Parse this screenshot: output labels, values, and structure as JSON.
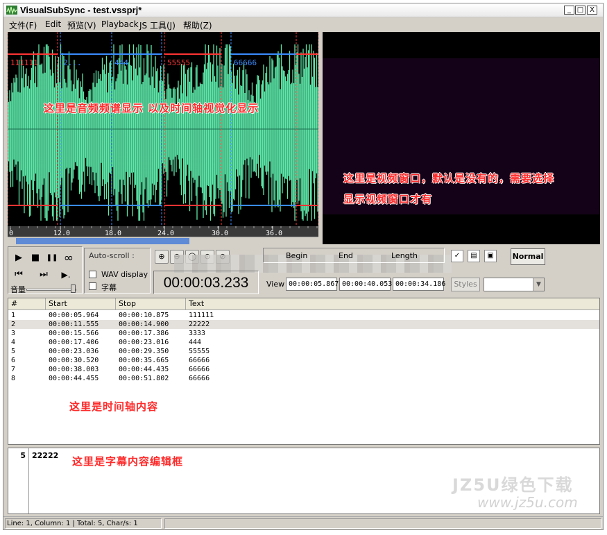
{
  "window": {
    "title": "VisualSubSync - test.vssprj*",
    "controls": [
      "_",
      "□",
      "X"
    ]
  },
  "menu": [
    "文件(F)",
    "Edit",
    "预览(V)",
    "Playback",
    "JS 工具(J)",
    "帮助(Z)"
  ],
  "waveform": {
    "annotation": "这里是音频频谱显示 以及时间轴视觉化显示",
    "subtitle_labels": [
      {
        "text": "111111",
        "color": "#ff3333"
      },
      {
        "text": "2...",
        "color": "#3a8cff"
      },
      {
        "text": "444",
        "color": "#3a8cff"
      },
      {
        "text": "55555",
        "color": "#ff3333"
      },
      {
        "text": "66666",
        "color": "#3a8cff"
      }
    ],
    "ruler_ticks": [
      "0",
      "12.0",
      "18.0",
      "24.0",
      "30.0",
      "36.0"
    ],
    "wave_color": "#5ce8a8",
    "background": "#000000"
  },
  "video": {
    "annotation_line1": "这里是视频窗口，默认是没有的，需要选择",
    "annotation_line2": "显示视频窗口才有",
    "background": "#140318"
  },
  "playback": {
    "buttons": [
      {
        "name": "play-icon",
        "glyph": "▶"
      },
      {
        "name": "stop-icon",
        "glyph": "■"
      },
      {
        "name": "pause-icon",
        "glyph": "❚❚"
      },
      {
        "name": "loop-icon",
        "glyph": "∞"
      },
      {
        "name": "rewind-icon",
        "glyph": "⏮"
      },
      {
        "name": "forward-icon",
        "glyph": "⏭"
      },
      {
        "name": "step-play-icon",
        "glyph": "▶."
      }
    ],
    "volume_label": "音量"
  },
  "autoscroll": {
    "title": "Auto-scroll :",
    "wav_display": "WAV display",
    "subtitles": "字幕"
  },
  "zoom_buttons": [
    "⊕",
    "⊖",
    "◯",
    "⊙",
    "⊘"
  ],
  "timecode": "00:00:03.233",
  "range": {
    "begin_label": "Begin",
    "end_label": "End",
    "length_label": "Length",
    "view_label": "View",
    "begin": "00:00:05.867",
    "end": "00:00:40.053",
    "length": "00:00:34.186"
  },
  "tools": {
    "normal_label": "Normal",
    "styles_label": "Styles"
  },
  "subtitle_list": {
    "columns": [
      "#",
      "Start",
      "Stop",
      "Text"
    ],
    "rows": [
      {
        "n": "1",
        "start": "00:00:05.964",
        "stop": "00:00:10.875",
        "text": "111111"
      },
      {
        "n": "2",
        "start": "00:00:11.555",
        "stop": "00:00:14.900",
        "text": "22222"
      },
      {
        "n": "3",
        "start": "00:00:15.566",
        "stop": "00:00:17.386",
        "text": "3333"
      },
      {
        "n": "4",
        "start": "00:00:17.406",
        "stop": "00:00:23.016",
        "text": "444"
      },
      {
        "n": "5",
        "start": "00:00:23.036",
        "stop": "00:00:29.350",
        "text": "55555"
      },
      {
        "n": "6",
        "start": "00:00:30.520",
        "stop": "00:00:35.665",
        "text": "66666"
      },
      {
        "n": "7",
        "start": "00:00:38.003",
        "stop": "00:00:44.435",
        "text": "66666"
      },
      {
        "n": "8",
        "start": "00:00:44.455",
        "stop": "00:00:51.802",
        "text": "66666"
      }
    ],
    "selected_index": 1,
    "annotation": "这里是时间轴内容"
  },
  "editor": {
    "line_number": "5",
    "text": "22222",
    "annotation": "这里是字幕内容编辑框",
    "watermark": "JZ5U绿色下载",
    "watermark_url": "www.jz5u.com"
  },
  "status": {
    "text": "Line: 1, Column: 1 | Total: 5, Char/s: 1"
  }
}
